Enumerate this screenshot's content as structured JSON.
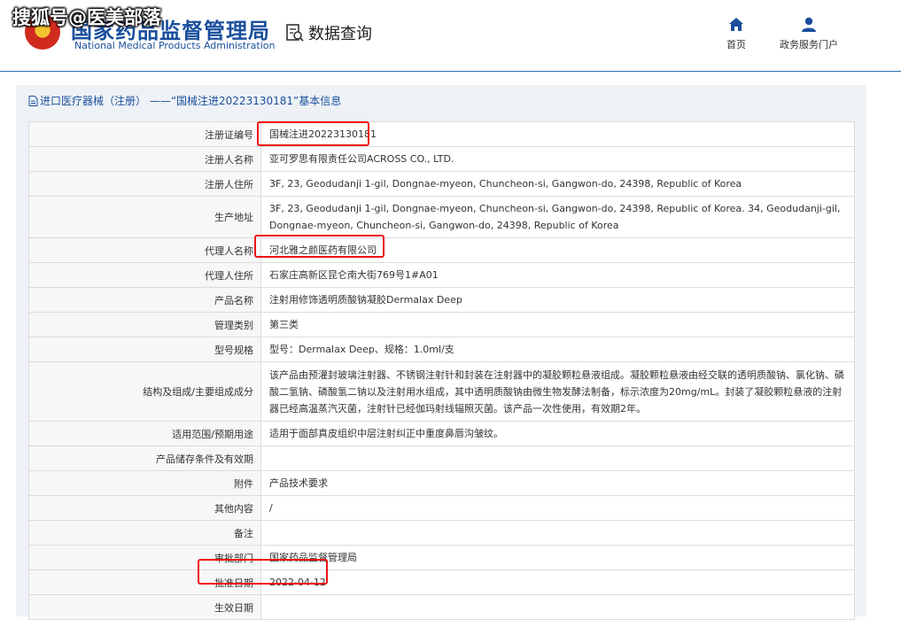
{
  "watermark": "搜狐号@医美部落",
  "header": {
    "logo_cn": "国家药品监督管理局",
    "logo_en": "National Medical Products Administration",
    "query_label": "数据查询",
    "nav": [
      {
        "label": "首页",
        "icon": "home-icon"
      },
      {
        "label": "政务服务门户",
        "icon": "user-icon"
      }
    ]
  },
  "panel": {
    "title": "进口医疗器械（注册） ——“国械注进20223130181”基本信息"
  },
  "rows": [
    {
      "label": "注册证编号",
      "value": "国械注进20223130181"
    },
    {
      "label": "注册人名称",
      "value": "亚可罗思有限责任公司ACROSS CO., LTD."
    },
    {
      "label": "注册人住所",
      "value": "3F, 23, Geodudanji 1-gil, Dongnae-myeon, Chuncheon-si, Gangwon-do, 24398, Republic of Korea"
    },
    {
      "label": "生产地址",
      "value": "3F, 23, Geodudanji 1-gil, Dongnae-myeon, Chuncheon-si, Gangwon-do, 24398, Republic of Korea. 34, Geodudanji-gil, Dongnae-myeon, Chuncheon-si, Gangwon-do, 24398, Republic of Korea"
    },
    {
      "label": "代理人名称",
      "value": "河北雅之颜医药有限公司"
    },
    {
      "label": "代理人住所",
      "value": "石家庄高新区昆仑南大街769号1#A01"
    },
    {
      "label": "产品名称",
      "value": "注射用修饰透明质酸钠凝胶Dermalax Deep"
    },
    {
      "label": "管理类别",
      "value": "第三类"
    },
    {
      "label": "型号规格",
      "value": "型号：Dermalax Deep、规格：1.0ml/支"
    },
    {
      "label": "结构及组成/主要组成成分",
      "value": "该产品由预灌封玻璃注射器、不锈钢注射针和封装在注射器中的凝胶颗粒悬液组成。凝胶颗粒悬液由经交联的透明质酸钠、氯化钠、磷酸二氢钠、磷酸氢二钠以及注射用水组成，其中透明质酸钠由微生物发酵法制备，标示浓度为20mg/mL。封装了凝胶颗粒悬液的注射器已经高温蒸汽灭菌，注射针已经伽玛射线辐照灭菌。该产品一次性使用，有效期2年。"
    },
    {
      "label": "适用范围/预期用途",
      "value": "适用于面部真皮组织中层注射纠正中重度鼻唇沟皱纹。"
    },
    {
      "label": "产品储存条件及有效期",
      "value": ""
    },
    {
      "label": "附件",
      "value": "产品技术要求"
    },
    {
      "label": "其他内容",
      "value": "/"
    },
    {
      "label": "备注",
      "value": ""
    },
    {
      "label": "审批部门",
      "value": "国家药品监督管理局"
    },
    {
      "label": "批准日期",
      "value": "2022-04-12"
    },
    {
      "label": "生效日期",
      "value": ""
    }
  ],
  "colors": {
    "brand": "#1a4f9c",
    "highlight": "#e11111",
    "panel_bg": "#eef2f6"
  }
}
